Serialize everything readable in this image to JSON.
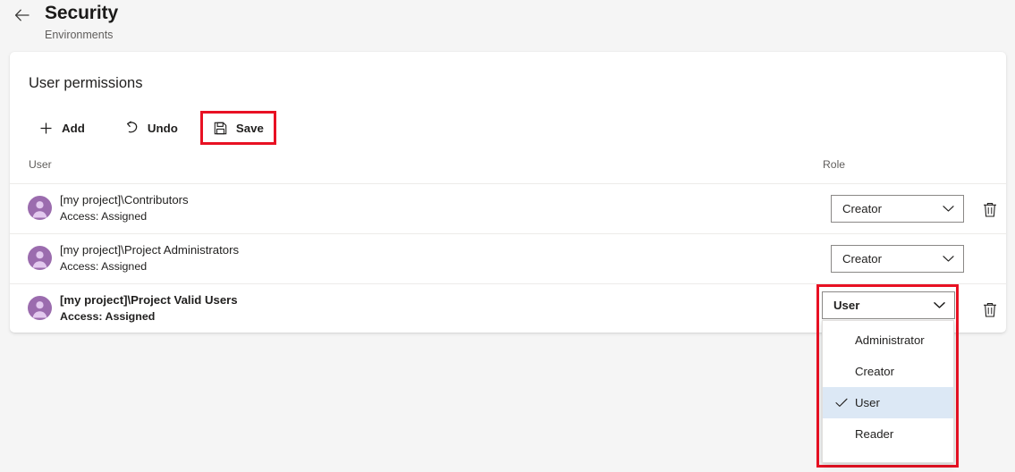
{
  "header": {
    "back_icon": "arrow-left-icon",
    "title": "Security",
    "subtitle": "Environments"
  },
  "card": {
    "title": "User permissions"
  },
  "toolbar": {
    "add": {
      "label": "Add",
      "icon": "plus-icon"
    },
    "undo": {
      "label": "Undo",
      "icon": "undo-icon"
    },
    "save": {
      "label": "Save",
      "icon": "save-floppy-icon",
      "highlighted": true
    }
  },
  "table": {
    "columns": {
      "user": "User",
      "role": "Role"
    },
    "rows": [
      {
        "avatar_icon": "group-avatar-icon",
        "name": "[my project]\\Contributors",
        "access": "Access: Assigned",
        "role": "Creator",
        "delete_icon": "trash-icon",
        "show_delete": true,
        "active": false
      },
      {
        "avatar_icon": "group-avatar-icon",
        "name": "[my project]\\Project Administrators",
        "access": "Access: Assigned",
        "role": "Creator",
        "delete_icon": "trash-icon",
        "show_delete": false,
        "active": false
      },
      {
        "avatar_icon": "group-avatar-icon",
        "name": "[my project]\\Project Valid Users",
        "access": "Access: Assigned",
        "role": "User",
        "delete_icon": "trash-icon",
        "show_delete": true,
        "active": true
      }
    ]
  },
  "role_dropdown": {
    "open": true,
    "selected": "User",
    "check_icon": "checkmark-icon",
    "chevron_icon": "chevron-down-icon",
    "options": [
      {
        "label": "Administrator",
        "selected": false
      },
      {
        "label": "Creator",
        "selected": false
      },
      {
        "label": "User",
        "selected": true
      },
      {
        "label": "Reader",
        "selected": false
      }
    ]
  },
  "colors": {
    "page_background": "#f5f5f5",
    "card_background": "#ffffff",
    "highlight_red": "#e81123",
    "avatar_purple": "#9b6cae",
    "avatar_purple_light": "#e3c9ef",
    "selected_option_background": "#dce8f5",
    "text_primary": "#201f1e",
    "text_secondary": "#605e5c",
    "divider": "#edebe9",
    "control_border": "#8a8886"
  }
}
